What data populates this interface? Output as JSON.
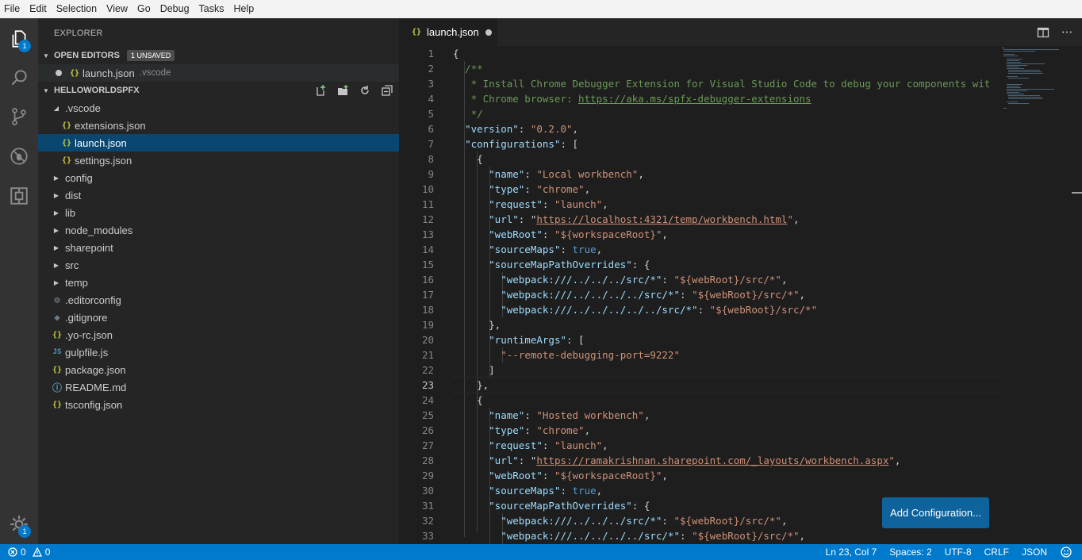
{
  "menu": [
    "File",
    "Edit",
    "Selection",
    "View",
    "Go",
    "Debug",
    "Tasks",
    "Help"
  ],
  "activity": {
    "explorer_badge": "1",
    "settings_badge": "1"
  },
  "sidebar": {
    "title": "EXPLORER",
    "open_editors": {
      "label": "OPEN EDITORS",
      "badge": "1 UNSAVED",
      "items": [
        {
          "name": "launch.json",
          "folder": ".vscode"
        }
      ]
    },
    "project": {
      "label": "HELLOWORLDSPFX",
      "tree": [
        {
          "label": ".vscode",
          "kind": "folder-open",
          "depth": 1
        },
        {
          "label": "extensions.json",
          "kind": "json",
          "depth": 2
        },
        {
          "label": "launch.json",
          "kind": "json",
          "depth": 2,
          "selected": true
        },
        {
          "label": "settings.json",
          "kind": "json",
          "depth": 2
        },
        {
          "label": "config",
          "kind": "folder",
          "depth": 1
        },
        {
          "label": "dist",
          "kind": "folder",
          "depth": 1
        },
        {
          "label": "lib",
          "kind": "folder",
          "depth": 1
        },
        {
          "label": "node_modules",
          "kind": "folder",
          "depth": 1
        },
        {
          "label": "sharepoint",
          "kind": "folder",
          "depth": 1
        },
        {
          "label": "src",
          "kind": "folder",
          "depth": 1
        },
        {
          "label": "temp",
          "kind": "folder",
          "depth": 1
        },
        {
          "label": ".editorconfig",
          "kind": "gear",
          "depth": 1
        },
        {
          "label": ".gitignore",
          "kind": "git",
          "depth": 1
        },
        {
          "label": ".yo-rc.json",
          "kind": "json",
          "depth": 1
        },
        {
          "label": "gulpfile.js",
          "kind": "js",
          "depth": 1
        },
        {
          "label": "package.json",
          "kind": "json",
          "depth": 1
        },
        {
          "label": "README.md",
          "kind": "info",
          "depth": 1
        },
        {
          "label": "tsconfig.json",
          "kind": "json",
          "depth": 1
        }
      ]
    }
  },
  "editor": {
    "tab": "launch.json",
    "add_config_label": "Add Configuration...",
    "lines": [
      "{",
      "  /**",
      "   * Install Chrome Debugger Extension for Visual Studio Code to debug your components wit",
      "   * Chrome browser: https://aka.ms/spfx-debugger-extensions",
      "   */",
      "  \"version\": \"0.2.0\",",
      "  \"configurations\": [",
      "    {",
      "      \"name\": \"Local workbench\",",
      "      \"type\": \"chrome\",",
      "      \"request\": \"launch\",",
      "      \"url\": \"https://localhost:4321/temp/workbench.html\",",
      "      \"webRoot\": \"${workspaceRoot}\",",
      "      \"sourceMaps\": true,",
      "      \"sourceMapPathOverrides\": {",
      "        \"webpack:///../../../src/*\": \"${webRoot}/src/*\",",
      "        \"webpack:///../../../../src/*\": \"${webRoot}/src/*\",",
      "        \"webpack:///../../../../../src/*\": \"${webRoot}/src/*\"",
      "      },",
      "      \"runtimeArgs\": [",
      "        \"--remote-debugging-port=9222\"",
      "      ]",
      "    },",
      "    {",
      "      \"name\": \"Hosted workbench\",",
      "      \"type\": \"chrome\",",
      "      \"request\": \"launch\",",
      "      \"url\": \"https://ramakrishnan.sharepoint.com/_layouts/workbench.aspx\",",
      "      \"webRoot\": \"${workspaceRoot}\",",
      "      \"sourceMaps\": true,",
      "      \"sourceMapPathOverrides\": {",
      "        \"webpack:///../../../src/*\": \"${webRoot}/src/*\",",
      "        \"webpack:///../../../../src/*\": \"${webRoot}/src/*\","
    ]
  },
  "status": {
    "errors": "0",
    "warnings": "0",
    "position": "Ln 23, Col 7",
    "spaces": "Spaces: 2",
    "encoding": "UTF-8",
    "eol": "CRLF",
    "language": "JSON"
  },
  "colors": {
    "accent": "#007acc",
    "selection": "#094771"
  }
}
